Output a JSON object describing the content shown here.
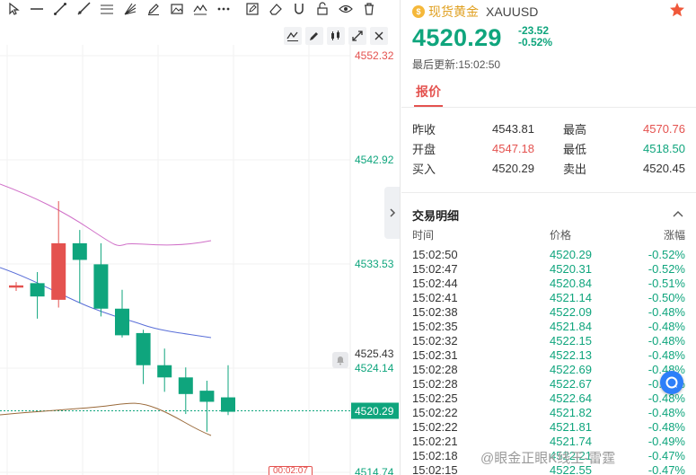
{
  "chart": {
    "price_levels": [
      "4552.32",
      "4542.92",
      "4533.53",
      "4525.43",
      "4524.14",
      "4520.29",
      "4514.74"
    ],
    "timer": "00:02:07",
    "colors": {
      "up": "#e4524f",
      "down": "#0fa57d",
      "ma_upper": "#d070c8",
      "ma_mid": "#5a6fd8",
      "ma_lower": "#9a6a3a",
      "current_line": "#0fa57d"
    }
  },
  "chart_data": {
    "type": "candlestick",
    "y_axis_ticks": [
      4552.32,
      4542.92,
      4533.53,
      4524.14,
      4514.74
    ],
    "current_price": 4520.29,
    "alert_level": 4525.43,
    "candles": [
      {
        "open": 4531.4,
        "close": 4531.6,
        "high": 4531.9,
        "low": 4531.1
      },
      {
        "open": 4531.8,
        "close": 4530.6,
        "high": 4532.8,
        "low": 4528.6
      },
      {
        "open": 4530.3,
        "close": 4535.4,
        "high": 4539.2,
        "low": 4529.6
      },
      {
        "open": 4535.4,
        "close": 4533.9,
        "high": 4536.6,
        "low": 4530.0
      },
      {
        "open": 4533.5,
        "close": 4529.5,
        "high": 4535.4,
        "low": 4528.8
      },
      {
        "open": 4529.5,
        "close": 4527.1,
        "high": 4531.2,
        "low": 4526.9
      },
      {
        "open": 4527.3,
        "close": 4524.4,
        "high": 4527.6,
        "low": 4522.7
      },
      {
        "open": 4524.4,
        "close": 4523.3,
        "high": 4525.9,
        "low": 4522.0
      },
      {
        "open": 4523.3,
        "close": 4521.8,
        "high": 4524.2,
        "low": 4520.0
      },
      {
        "open": 4522.1,
        "close": 4521.1,
        "high": 4523.0,
        "low": 4518.4
      },
      {
        "open": 4521.5,
        "close": 4520.2,
        "high": 4524.4,
        "low": 4519.9
      }
    ]
  },
  "quote": {
    "name": "现货黄金",
    "symbol": "XAUUSD",
    "price": "4520.29",
    "change": "-23.52",
    "change_pct": "-0.52%",
    "updated": "最后更新:15:02:50",
    "tab": "报价",
    "stats": {
      "prev_close_label": "昨收",
      "prev_close": "4543.81",
      "high_label": "最高",
      "high": "4570.76",
      "open_label": "开盘",
      "open": "4547.18",
      "low_label": "最低",
      "low": "4518.50",
      "bid_label": "买入",
      "bid": "4520.29",
      "ask_label": "卖出",
      "ask": "4520.45"
    }
  },
  "trades": {
    "title": "交易明细",
    "headers": [
      "时间",
      "价格",
      "涨幅"
    ],
    "rows": [
      [
        "15:02:50",
        "4520.29",
        "-0.52%"
      ],
      [
        "15:02:47",
        "4520.31",
        "-0.52%"
      ],
      [
        "15:02:44",
        "4520.84",
        "-0.51%"
      ],
      [
        "15:02:41",
        "4521.14",
        "-0.50%"
      ],
      [
        "15:02:38",
        "4522.09",
        "-0.48%"
      ],
      [
        "15:02:35",
        "4521.84",
        "-0.48%"
      ],
      [
        "15:02:32",
        "4522.15",
        "-0.48%"
      ],
      [
        "15:02:31",
        "4522.13",
        "-0.48%"
      ],
      [
        "15:02:28",
        "4522.69",
        "-0.48%"
      ],
      [
        "15:02:28",
        "4522.67",
        "-0.48%"
      ],
      [
        "15:02:25",
        "4522.64",
        "-0.48%"
      ],
      [
        "15:02:22",
        "4521.82",
        "-0.48%"
      ],
      [
        "15:02:22",
        "4521.81",
        "-0.48%"
      ],
      [
        "15:02:21",
        "4521.74",
        "-0.49%"
      ],
      [
        "15:02:18",
        "4522.21",
        "-0.47%"
      ],
      [
        "15:02:15",
        "4522.55",
        "-0.47%"
      ]
    ]
  },
  "watermark": "@眼金正眼K线王-雷霆"
}
